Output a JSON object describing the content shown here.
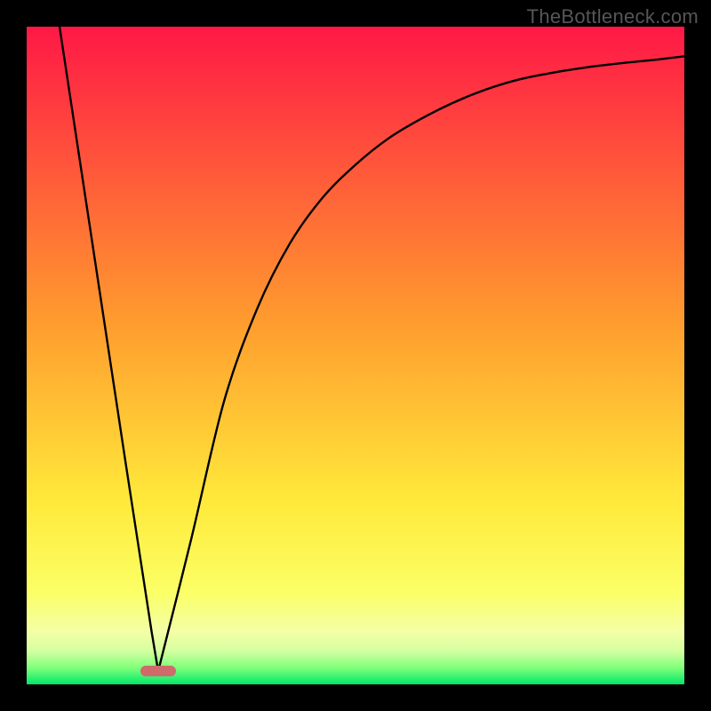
{
  "watermark": "TheBottleneck.com",
  "chart_data": {
    "type": "line",
    "title": "",
    "xlabel": "",
    "ylabel": "",
    "xlim": [
      0,
      100
    ],
    "ylim": [
      0,
      100
    ],
    "grid": false,
    "annotations": [],
    "series": [
      {
        "name": "curve",
        "color": "#000000",
        "x": [
          5,
          10,
          15,
          17,
          19,
          20,
          25,
          30,
          35,
          40,
          45,
          50,
          55,
          60,
          65,
          70,
          75,
          80,
          85,
          90,
          95,
          100
        ],
        "y": [
          100,
          67,
          34,
          21,
          8,
          2,
          22,
          43,
          57,
          67,
          74,
          79,
          83,
          86,
          88.5,
          90.5,
          92,
          93,
          93.8,
          94.4,
          94.9,
          95.5
        ]
      }
    ],
    "marker": {
      "x": 20,
      "y": 2,
      "width_pct": 5.4,
      "height_pct": 1.6,
      "color": "#cf6b6b"
    },
    "gradient_stops": [
      {
        "offset": 0,
        "color": "#ff1846"
      },
      {
        "offset": 45,
        "color": "#ff9c2e"
      },
      {
        "offset": 72,
        "color": "#ffe93a"
      },
      {
        "offset": 86,
        "color": "#fbff66"
      },
      {
        "offset": 92,
        "color": "#f4ffa6"
      },
      {
        "offset": 95,
        "color": "#d3ffa0"
      },
      {
        "offset": 97.5,
        "color": "#7fff7a"
      },
      {
        "offset": 100,
        "color": "#00e86a"
      }
    ]
  }
}
